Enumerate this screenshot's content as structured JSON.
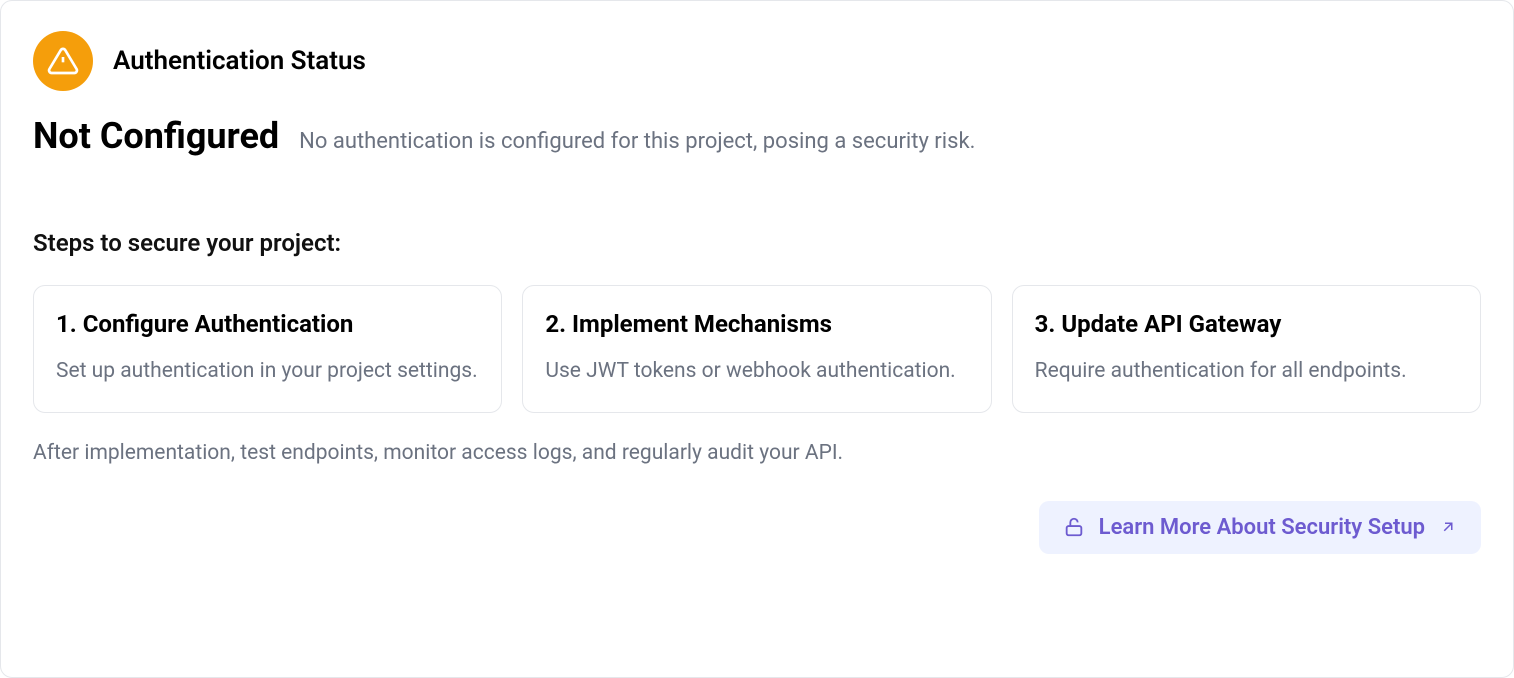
{
  "header": {
    "title": "Authentication Status"
  },
  "status": {
    "label": "Not Configured",
    "description": "No authentication is configured for this project, posing a security risk."
  },
  "steps": {
    "title": "Steps to secure your project:",
    "items": [
      {
        "title": "1. Configure Authentication",
        "description": "Set up authentication in your project settings."
      },
      {
        "title": "2. Implement Mechanisms",
        "description": "Use JWT tokens or webhook authentication."
      },
      {
        "title": "3. Update API Gateway",
        "description": "Require authentication for all endpoints."
      }
    ]
  },
  "footer": {
    "text": "After implementation, test endpoints, monitor access logs, and regularly audit your API."
  },
  "action": {
    "label": "Learn More About Security Setup"
  }
}
